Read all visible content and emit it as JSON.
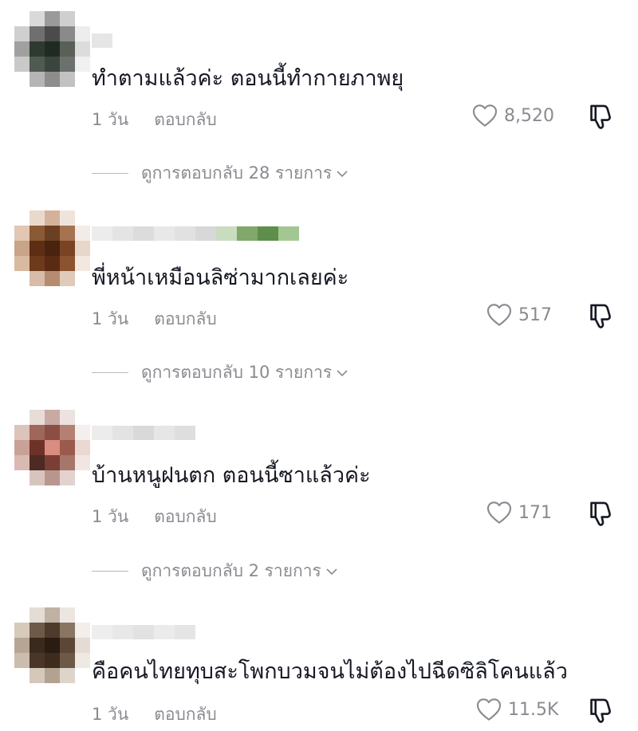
{
  "comments": [
    {
      "text": "ทำตามแล้วค่ะ ตอนนี้ทำกายภาพยุ",
      "time": "1 วัน",
      "reply_label": "ตอบกลับ",
      "likes": "8,520",
      "view_replies": "ดูการตอบกลับ 28 รายการ",
      "avatar_colors": [
        "#ffffff",
        "#d9d9d9",
        "#9a9a9a",
        "#cfcfcf",
        "#ffffff",
        "#cfcfcf",
        "#6f6f6f",
        "#4b4b4b",
        "#8a8a8a",
        "#ededed",
        "#a0a0a0",
        "#2f3a2f",
        "#1f2a22",
        "#5a5f58",
        "#dcdcdc",
        "#c9c9c9",
        "#505a50",
        "#3b4540",
        "#6d716d",
        "#f0f0f0",
        "#ffffff",
        "#b5b5b5",
        "#8d8d8d",
        "#c2c2c2",
        "#ffffff"
      ],
      "username_colors": [
        "#e6e6e6"
      ]
    },
    {
      "text": "พี่หน้าเหมือนลิซ่ามากเลยค่ะ",
      "time": "1 วัน",
      "reply_label": "ตอบกลับ",
      "likes": "517",
      "view_replies": "ดูการตอบกลับ 10 รายการ",
      "avatar_colors": [
        "#ffffff",
        "#e9d9cc",
        "#d4b299",
        "#efe4dc",
        "#ffffff",
        "#e2c7b3",
        "#8a5a35",
        "#6b3f22",
        "#a57350",
        "#f3ece6",
        "#c9a488",
        "#5e2e14",
        "#4a2210",
        "#7a4424",
        "#e8d6c9",
        "#d9b9a0",
        "#6d3a1c",
        "#5a2b12",
        "#8c5331",
        "#f2e8e0",
        "#ffffff",
        "#d7bca8",
        "#b58c70",
        "#e0cbbb",
        "#ffffff"
      ],
      "username_colors": [
        "#ececec",
        "#e4e4e4",
        "#dcdcdc",
        "#e8e8e8",
        "#e1e1e1",
        "#d8d8d8",
        "#c9dcc0",
        "#7fa86a",
        "#5e8f4a",
        "#a3c793"
      ]
    },
    {
      "text": "บ้านหนูฝนตก ตอนนี้ซาแล้วค่ะ",
      "time": "1 วัน",
      "reply_label": "ตอบกลับ",
      "likes": "171",
      "view_replies": "ดูการตอบกลับ 2 รายการ",
      "avatar_colors": [
        "#ffffff",
        "#e7dcd8",
        "#c9aaa2",
        "#ece3e0",
        "#ffffff",
        "#dcc3bc",
        "#a0665a",
        "#8a4e44",
        "#b58074",
        "#f4eeec",
        "#caa197",
        "#6e3228",
        "#d98c80",
        "#9b5a4e",
        "#ead8d3",
        "#d9bab2",
        "#4d2a24",
        "#7a3e34",
        "#a7766b",
        "#f1e6e3",
        "#ffffff",
        "#d8c4bf",
        "#b9968d",
        "#e3d3cf",
        "#ffffff"
      ],
      "username_colors": [
        "#ececec",
        "#e3e3e3",
        "#d9d9d9",
        "#e6e6e6",
        "#dedede"
      ]
    },
    {
      "text": "คือคนไทยทุบสะโพกบวมจนไม่ต้องไปฉีดซิลิโคนแล้ว",
      "time": "1 วัน",
      "reply_label": "ตอบกลับ",
      "likes": "11.5K",
      "view_replies": "",
      "avatar_colors": [
        "#ffffff",
        "#e3ddd6",
        "#bfb2a4",
        "#ebe6e1",
        "#ffffff",
        "#d6cabd",
        "#6e5a48",
        "#4e3b2c",
        "#8a7562",
        "#f2eeea",
        "#b7a593",
        "#3a2a1e",
        "#2a1c12",
        "#5c4636",
        "#e4dcd4",
        "#cbbcad",
        "#4a3627",
        "#3d2b1e",
        "#6e5846",
        "#efe9e3",
        "#ffffff",
        "#d4c8bb",
        "#b3a28f",
        "#ded4ca",
        "#ffffff"
      ],
      "username_colors": [
        "#eeeeee",
        "#e8e8e8",
        "#e2e2e2",
        "#ebebeb",
        "#e5e5e5"
      ]
    }
  ]
}
